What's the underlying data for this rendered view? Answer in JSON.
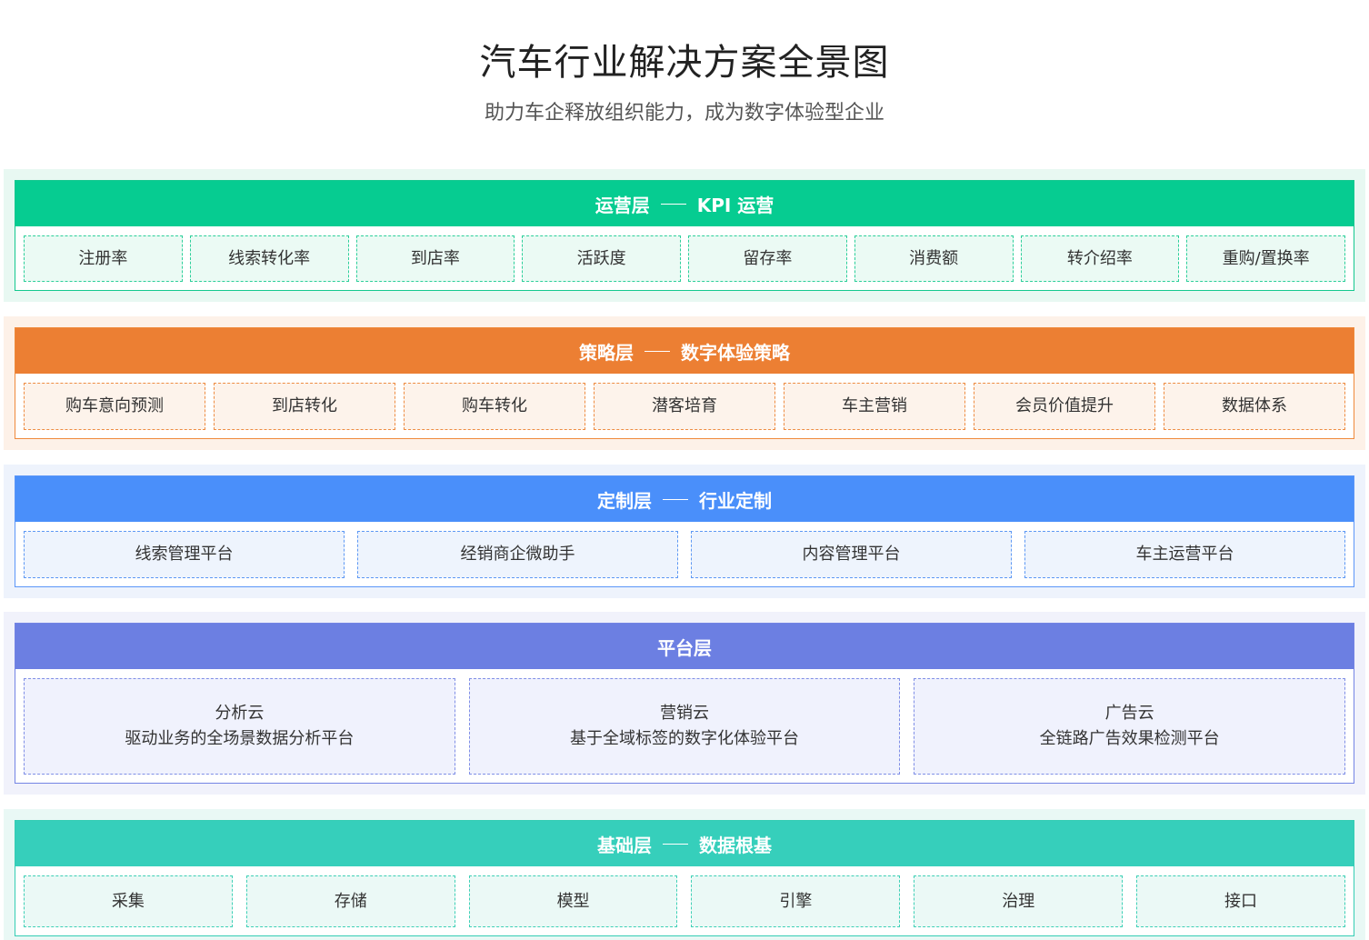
{
  "title": "汽车行业解决方案全景图",
  "subtitle": "助力车企释放组织能力，成为数字体验型企业",
  "colors": {
    "operations": "#06cc91",
    "strategy": "#ec7f33",
    "custom": "#4a8ffa",
    "platform": "#6c7fe2",
    "base": "#36cfbb"
  },
  "layers": {
    "operations": {
      "name": "运营层",
      "desc": "KPI 运营",
      "items": [
        "注册率",
        "线索转化率",
        "到店率",
        "活跃度",
        "留存率",
        "消费额",
        "转介绍率",
        "重购/置换率"
      ]
    },
    "strategy": {
      "name": "策略层",
      "desc": "数字体验策略",
      "items": [
        "购车意向预测",
        "到店转化",
        "购车转化",
        "潜客培育",
        "车主营销",
        "会员价值提升",
        "数据体系"
      ]
    },
    "custom": {
      "name": "定制层",
      "desc": "行业定制",
      "items": [
        "线索管理平台",
        "经销商企微助手",
        "内容管理平台",
        "车主运营平台"
      ]
    },
    "platform": {
      "name": "平台层",
      "items": [
        {
          "name": "分析云",
          "desc": "驱动业务的全场景数据分析平台"
        },
        {
          "name": "营销云",
          "desc": "基于全域标签的数字化体验平台"
        },
        {
          "name": "广告云",
          "desc": "全链路广告效果检测平台"
        }
      ]
    },
    "base": {
      "name": "基础层",
      "desc": "数据根基",
      "items": [
        "采集",
        "存储",
        "模型",
        "引擎",
        "治理",
        "接口"
      ]
    }
  }
}
